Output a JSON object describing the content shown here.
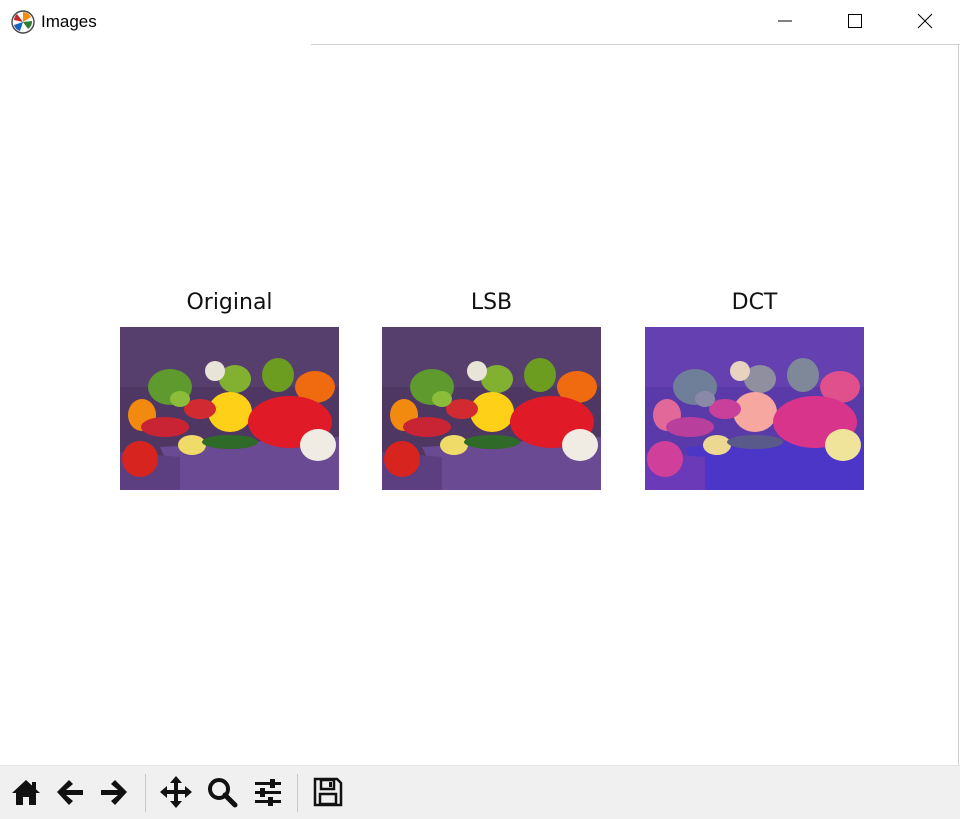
{
  "window": {
    "title": "Images",
    "controls": {
      "minimize": "minimize-icon",
      "maximize": "maximize-icon",
      "close": "close-icon"
    }
  },
  "figure": {
    "subplots": [
      {
        "title": "Original",
        "variant": "original"
      },
      {
        "title": "LSB",
        "variant": "lsb"
      },
      {
        "title": "DCT",
        "variant": "dct"
      }
    ]
  },
  "toolbar": {
    "buttons": [
      {
        "icon": "home-icon"
      },
      {
        "icon": "back-arrow-icon"
      },
      {
        "icon": "forward-arrow-icon"
      },
      {
        "icon": "pan-icon"
      },
      {
        "icon": "zoom-icon"
      },
      {
        "icon": "subplots-config-icon"
      },
      {
        "icon": "save-icon"
      }
    ]
  },
  "colors": {
    "toolbar_bg": "#f0f0f0",
    "background_purple": "#5a3c6e",
    "dct_tint": "#6a3fd0"
  }
}
